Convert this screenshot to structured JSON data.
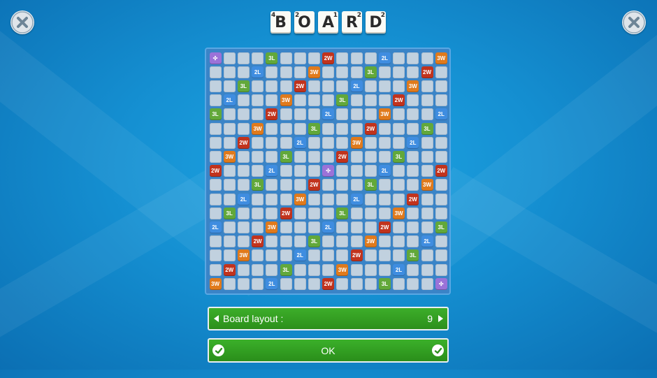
{
  "logo": {
    "tiles": [
      {
        "letter": "B",
        "points": "4",
        "pos": "right"
      },
      {
        "letter": "O",
        "points": "2",
        "pos": "left"
      },
      {
        "letter": "A",
        "points": "1",
        "pos": "right"
      },
      {
        "letter": "R",
        "points": "2",
        "pos": "right"
      },
      {
        "letter": "D",
        "points": "2",
        "pos": "right"
      }
    ]
  },
  "board": {
    "size": 17,
    "bonuses": [
      {
        "r": 0,
        "c": 0,
        "t": "ST"
      },
      {
        "r": 0,
        "c": 4,
        "t": "3L"
      },
      {
        "r": 0,
        "c": 8,
        "t": "2W"
      },
      {
        "r": 0,
        "c": 12,
        "t": "2L"
      },
      {
        "r": 0,
        "c": 16,
        "t": "3W"
      },
      {
        "r": 1,
        "c": 3,
        "t": "2L"
      },
      {
        "r": 1,
        "c": 7,
        "t": "3W"
      },
      {
        "r": 1,
        "c": 11,
        "t": "3L"
      },
      {
        "r": 1,
        "c": 15,
        "t": "2W"
      },
      {
        "r": 2,
        "c": 2,
        "t": "3L"
      },
      {
        "r": 2,
        "c": 6,
        "t": "2W"
      },
      {
        "r": 2,
        "c": 10,
        "t": "2L"
      },
      {
        "r": 2,
        "c": 14,
        "t": "3W"
      },
      {
        "r": 3,
        "c": 1,
        "t": "2L"
      },
      {
        "r": 3,
        "c": 5,
        "t": "3W"
      },
      {
        "r": 3,
        "c": 9,
        "t": "3L"
      },
      {
        "r": 3,
        "c": 13,
        "t": "2W"
      },
      {
        "r": 4,
        "c": 0,
        "t": "3L"
      },
      {
        "r": 4,
        "c": 4,
        "t": "2W"
      },
      {
        "r": 4,
        "c": 8,
        "t": "2L"
      },
      {
        "r": 4,
        "c": 12,
        "t": "3W"
      },
      {
        "r": 4,
        "c": 16,
        "t": "2L"
      },
      {
        "r": 5,
        "c": 3,
        "t": "3W"
      },
      {
        "r": 5,
        "c": 7,
        "t": "3L"
      },
      {
        "r": 5,
        "c": 11,
        "t": "2W"
      },
      {
        "r": 5,
        "c": 15,
        "t": "3L"
      },
      {
        "r": 6,
        "c": 2,
        "t": "2W"
      },
      {
        "r": 6,
        "c": 6,
        "t": "2L"
      },
      {
        "r": 6,
        "c": 10,
        "t": "3W"
      },
      {
        "r": 6,
        "c": 14,
        "t": "2L"
      },
      {
        "r": 7,
        "c": 1,
        "t": "3W"
      },
      {
        "r": 7,
        "c": 5,
        "t": "3L"
      },
      {
        "r": 7,
        "c": 9,
        "t": "2W"
      },
      {
        "r": 7,
        "c": 13,
        "t": "3L"
      },
      {
        "r": 8,
        "c": 0,
        "t": "2W"
      },
      {
        "r": 8,
        "c": 4,
        "t": "2L"
      },
      {
        "r": 8,
        "c": 8,
        "t": "ST"
      },
      {
        "r": 8,
        "c": 12,
        "t": "2L"
      },
      {
        "r": 8,
        "c": 16,
        "t": "2W"
      },
      {
        "r": 9,
        "c": 3,
        "t": "3L"
      },
      {
        "r": 9,
        "c": 7,
        "t": "2W"
      },
      {
        "r": 9,
        "c": 11,
        "t": "3L"
      },
      {
        "r": 9,
        "c": 15,
        "t": "3W"
      },
      {
        "r": 10,
        "c": 2,
        "t": "2L"
      },
      {
        "r": 10,
        "c": 6,
        "t": "3W"
      },
      {
        "r": 10,
        "c": 10,
        "t": "2L"
      },
      {
        "r": 10,
        "c": 14,
        "t": "2W"
      },
      {
        "r": 11,
        "c": 1,
        "t": "3L"
      },
      {
        "r": 11,
        "c": 5,
        "t": "2W"
      },
      {
        "r": 11,
        "c": 9,
        "t": "3L"
      },
      {
        "r": 11,
        "c": 13,
        "t": "3W"
      },
      {
        "r": 12,
        "c": 0,
        "t": "2L"
      },
      {
        "r": 12,
        "c": 4,
        "t": "3W"
      },
      {
        "r": 12,
        "c": 8,
        "t": "2L"
      },
      {
        "r": 12,
        "c": 12,
        "t": "2W"
      },
      {
        "r": 12,
        "c": 16,
        "t": "3L"
      },
      {
        "r": 13,
        "c": 3,
        "t": "2W"
      },
      {
        "r": 13,
        "c": 7,
        "t": "3L"
      },
      {
        "r": 13,
        "c": 11,
        "t": "3W"
      },
      {
        "r": 13,
        "c": 15,
        "t": "2L"
      },
      {
        "r": 14,
        "c": 2,
        "t": "3W"
      },
      {
        "r": 14,
        "c": 6,
        "t": "2L"
      },
      {
        "r": 14,
        "c": 10,
        "t": "2W"
      },
      {
        "r": 14,
        "c": 14,
        "t": "3L"
      },
      {
        "r": 15,
        "c": 1,
        "t": "2W"
      },
      {
        "r": 15,
        "c": 5,
        "t": "3L"
      },
      {
        "r": 15,
        "c": 9,
        "t": "3W"
      },
      {
        "r": 15,
        "c": 13,
        "t": "2L"
      },
      {
        "r": 16,
        "c": 0,
        "t": "3W"
      },
      {
        "r": 16,
        "c": 4,
        "t": "2L"
      },
      {
        "r": 16,
        "c": 8,
        "t": "2W"
      },
      {
        "r": 16,
        "c": 12,
        "t": "3L"
      },
      {
        "r": 16,
        "c": 16,
        "t": "ST"
      }
    ],
    "start_icon": "move-cross-icon"
  },
  "layout": {
    "label": "Board layout :",
    "value": "9"
  },
  "ok_label": "OK",
  "colors": {
    "2L": "#3f8de0",
    "3L": "#62a83a",
    "2W": "#c1331d",
    "3W": "#e07a1c",
    "start": "#9b72d8",
    "button_green": "#34a022"
  }
}
